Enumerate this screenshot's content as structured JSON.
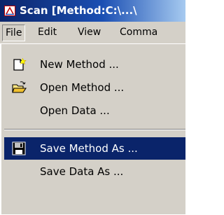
{
  "window": {
    "title": "Scan [Method:C:\\...\\",
    "icon": "scan-app-icon"
  },
  "menubar": {
    "items": [
      {
        "label": "File",
        "active": true
      },
      {
        "label": "Edit"
      },
      {
        "label": "View"
      },
      {
        "label": "Comma"
      }
    ]
  },
  "file_menu": {
    "items": [
      {
        "label": "New Method ...",
        "icon": "new-method-icon"
      },
      {
        "label": "Open Method ...",
        "icon": "open-folder-icon"
      },
      {
        "label": "Open Data ..."
      },
      {
        "label": "Save Method As ...",
        "icon": "floppy-disk-icon",
        "highlighted": true
      },
      {
        "label": "Save Data As ..."
      }
    ]
  },
  "colors": {
    "titlebar_start": "#0a246a",
    "titlebar_end": "#a6caf0",
    "menu_bg": "#d4d0c8",
    "highlight": "#0a246a"
  }
}
